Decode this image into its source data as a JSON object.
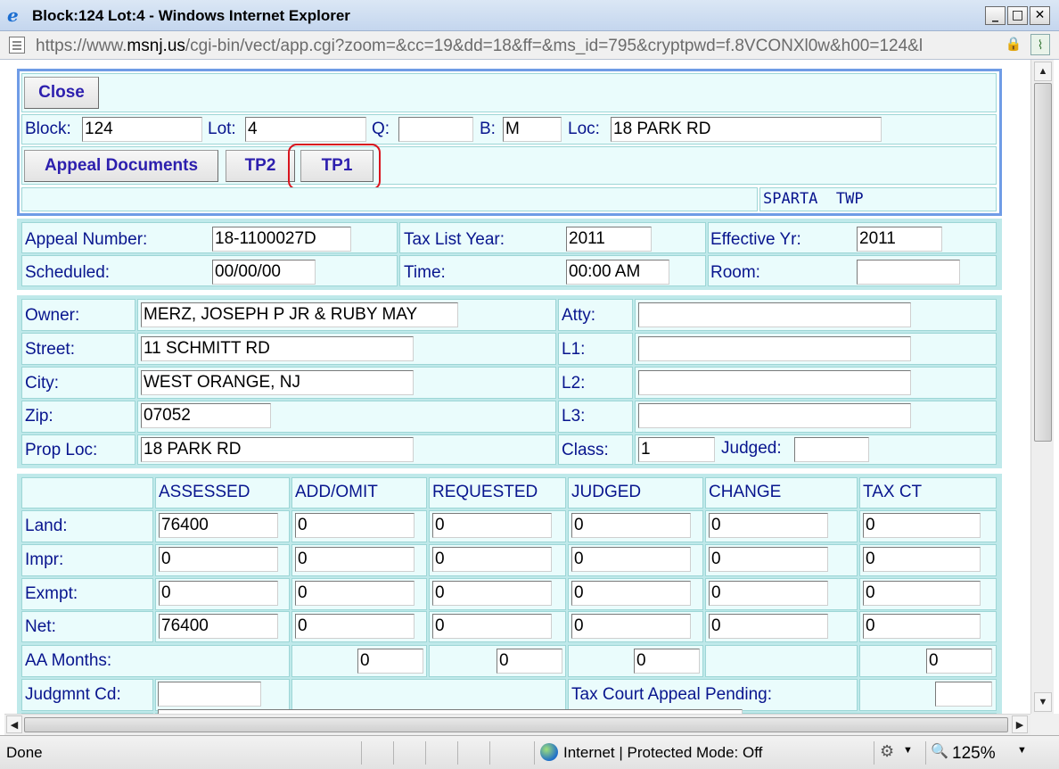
{
  "window": {
    "title": "Block:124 Lot:4 - Windows Internet Explorer",
    "minimize_glyph": "_",
    "maximize_glyph": "□",
    "close_glyph": "✕",
    "icon": "ie-logo-icon"
  },
  "address": {
    "url_prefix": "https://www.",
    "url_domain": "msnj.us",
    "url_rest": "/cgi-bin/vect/app.cgi?zoom=&cc=19&dd=18&ff=&ms_id=795&cryptpwd=f.8VCONXl0w&h00=124&l"
  },
  "toolbar": {
    "close_label": "Close",
    "block_label": "Block:",
    "block_value": "124",
    "lot_label": "Lot:",
    "lot_value": "4",
    "q_label": "Q:",
    "q_value": "",
    "b_label": "B:",
    "b_value": "M",
    "loc_label": "Loc:",
    "loc_value": "18 PARK RD",
    "appeal_docs_label": "Appeal Documents",
    "tp2_label": "TP2",
    "tp1_label": "TP1",
    "municipality": "SPARTA  TWP",
    "highlight_color": "#d9141e"
  },
  "appeal": {
    "appeal_number_label": "Appeal Number:",
    "appeal_number": "18-1100027D",
    "tax_list_year_label": "Tax List Year:",
    "tax_list_year": "2011",
    "effective_yr_label": "Effective Yr:",
    "effective_yr": "2011",
    "scheduled_label": "Scheduled:",
    "scheduled": "00/00/00",
    "time_label": "Time:",
    "time": "00:00 AM",
    "room_label": "Room:",
    "room": ""
  },
  "owner": {
    "owner_label": "Owner:",
    "owner": "MERZ, JOSEPH P JR & RUBY MAY",
    "street_label": "Street:",
    "street": "11 SCHMITT RD",
    "city_label": "City:",
    "city": "WEST ORANGE, NJ",
    "zip_label": "Zip:",
    "zip": "07052",
    "prop_loc_label": "Prop Loc:",
    "prop_loc": "18 PARK RD",
    "atty_label": "Atty:",
    "atty": "",
    "l1_label": "L1:",
    "l1": "",
    "l2_label": "L2:",
    "l2": "",
    "l3_label": "L3:",
    "l3": "",
    "class_label": "Class:",
    "class": "1",
    "judged_label": "Judged:",
    "judged": ""
  },
  "values_table": {
    "columns": [
      "ASSESSED",
      "ADD/OMIT",
      "REQUESTED",
      "JUDGED",
      "CHANGE",
      "TAX CT"
    ],
    "rows": [
      {
        "label": "Land:",
        "values": [
          "76400",
          "0",
          "0",
          "0",
          "0",
          "0"
        ]
      },
      {
        "label": "Impr:",
        "values": [
          "0",
          "0",
          "0",
          "0",
          "0",
          "0"
        ]
      },
      {
        "label": "Exmpt:",
        "values": [
          "0",
          "0",
          "0",
          "0",
          "0",
          "0"
        ]
      },
      {
        "label": "Net:",
        "values": [
          "76400",
          "0",
          "0",
          "0",
          "0",
          "0"
        ]
      }
    ],
    "aa_months_label": "AA Months:",
    "aa_months": [
      "0",
      "0",
      "0",
      "0"
    ],
    "judgment_cd_label": "Judgmnt Cd:",
    "judgment_cd": "",
    "tax_court_label": "Tax Court Appeal Pending:",
    "tax_court": ""
  },
  "scrollbars": {
    "up_glyph": "▲",
    "down_glyph": "▼",
    "left_glyph": "◀",
    "right_glyph": "▶"
  },
  "status": {
    "left_text": "Done",
    "zone_text": "Internet | Protected Mode: Off",
    "zoom_text": "125%",
    "dropdown_glyph": "▼"
  }
}
